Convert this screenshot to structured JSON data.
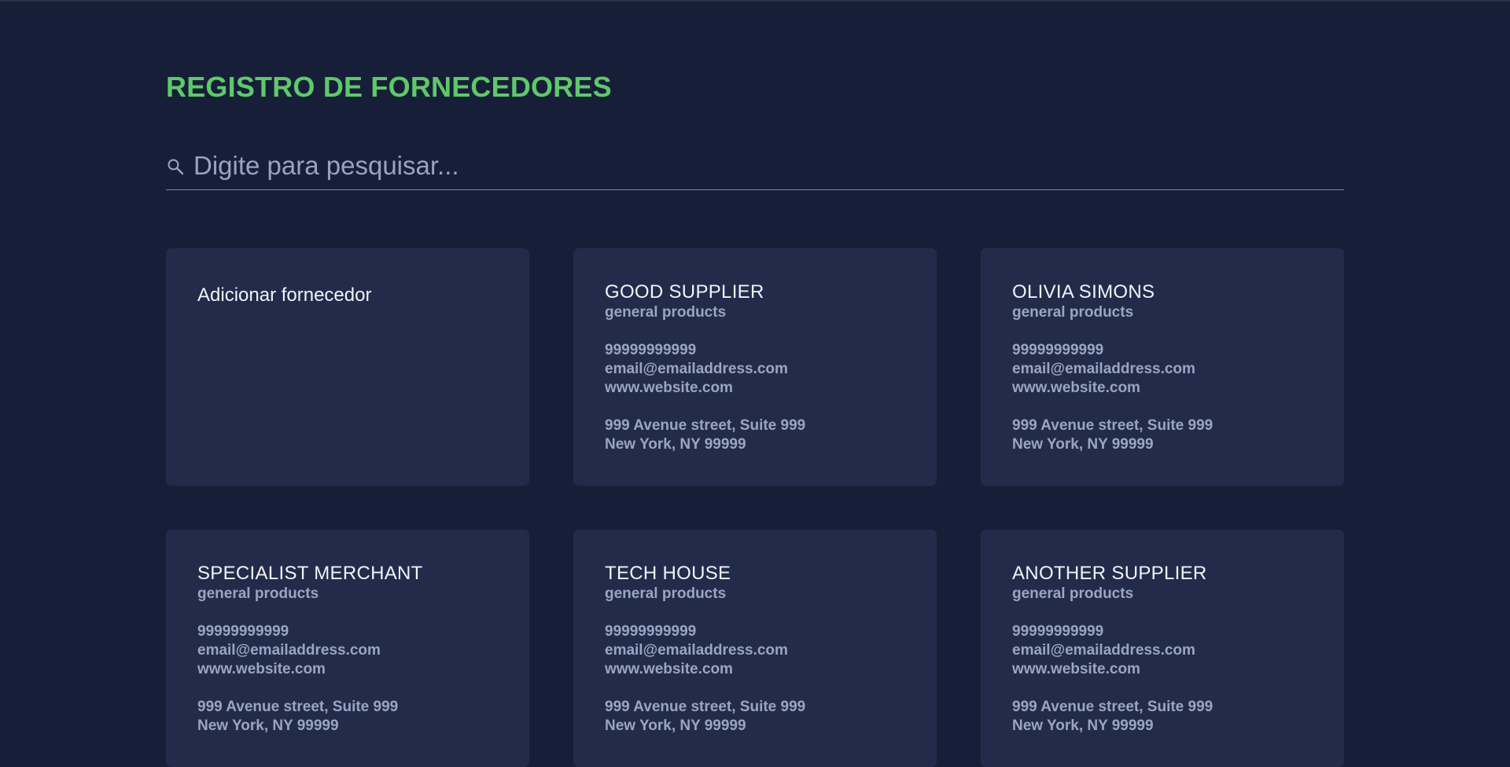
{
  "page": {
    "title": "REGISTRO DE FORNECEDORES"
  },
  "search": {
    "placeholder": "Digite para pesquisar...",
    "icon": "search-icon"
  },
  "add_card": {
    "label": "Adicionar fornecedor"
  },
  "suppliers": [
    {
      "name": "GOOD SUPPLIER",
      "category": "general products",
      "phone": "99999999999",
      "email": "email@emailaddress.com",
      "website": "www.website.com",
      "address_line1": "999 Avenue street, Suite 999",
      "address_line2": "New York, NY 99999"
    },
    {
      "name": "OLIVIA SIMONS",
      "category": "general products",
      "phone": "99999999999",
      "email": "email@emailaddress.com",
      "website": "www.website.com",
      "address_line1": "999 Avenue street, Suite 999",
      "address_line2": "New York, NY 99999"
    },
    {
      "name": "SPECIALIST MERCHANT",
      "category": "general products",
      "phone": "99999999999",
      "email": "email@emailaddress.com",
      "website": "www.website.com",
      "address_line1": "999 Avenue street, Suite 999",
      "address_line2": "New York, NY 99999"
    },
    {
      "name": "TECH HOUSE",
      "category": "general products",
      "phone": "99999999999",
      "email": "email@emailaddress.com",
      "website": "www.website.com",
      "address_line1": "999 Avenue street, Suite 999",
      "address_line2": "New York, NY 99999"
    },
    {
      "name": "ANOTHER SUPPLIER",
      "category": "general products",
      "phone": "99999999999",
      "email": "email@emailaddress.com",
      "website": "www.website.com",
      "address_line1": "999 Avenue street, Suite 999",
      "address_line2": "New York, NY 99999"
    }
  ],
  "colors": {
    "background": "#171f38",
    "card": "#222c4a",
    "title_accent": "#5ec96b",
    "muted_text": "#9aa5c4",
    "card_title": "#f1f3f8"
  }
}
